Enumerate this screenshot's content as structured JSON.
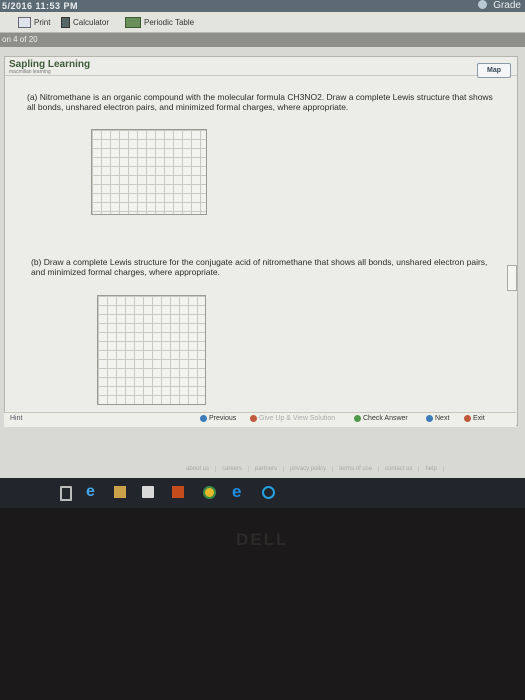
{
  "topbar": {
    "stamp": "5/2016 11:53 PM",
    "grade": "Grade"
  },
  "toolbar": {
    "print": "Print",
    "calculator": "Calculator",
    "periodic_table": "Periodic Table"
  },
  "qbar": {
    "question_counter": "on 4 of 20"
  },
  "brand": {
    "name": "Sapling Learning",
    "sub": "macmillan learning"
  },
  "map_button": "Map",
  "question_a": "(a) Nitromethane is an organic compound with the molecular formula CH3NO2. Draw a complete Lewis structure that shows all bonds, unshared electron pairs, and minimized formal charges, where appropriate.",
  "question_b": "(b) Draw a complete Lewis structure for the conjugate acid of nitromethane that shows all bonds, unshared electron pairs, and minimized formal charges, where appropriate.",
  "nav": {
    "hint": "Hint",
    "previous": "Previous",
    "give_up": "Give Up & View Solution",
    "check": "Check Answer",
    "next": "Next",
    "exit": "Exit"
  },
  "footer": [
    "about us",
    "careers",
    "partners",
    "privacy policy",
    "terms of use",
    "contact us",
    "help"
  ],
  "colors": {
    "brand": "#3e5b3a",
    "bezel": "#1b1919",
    "taskbar": "#22262c"
  },
  "logo": "DELL"
}
